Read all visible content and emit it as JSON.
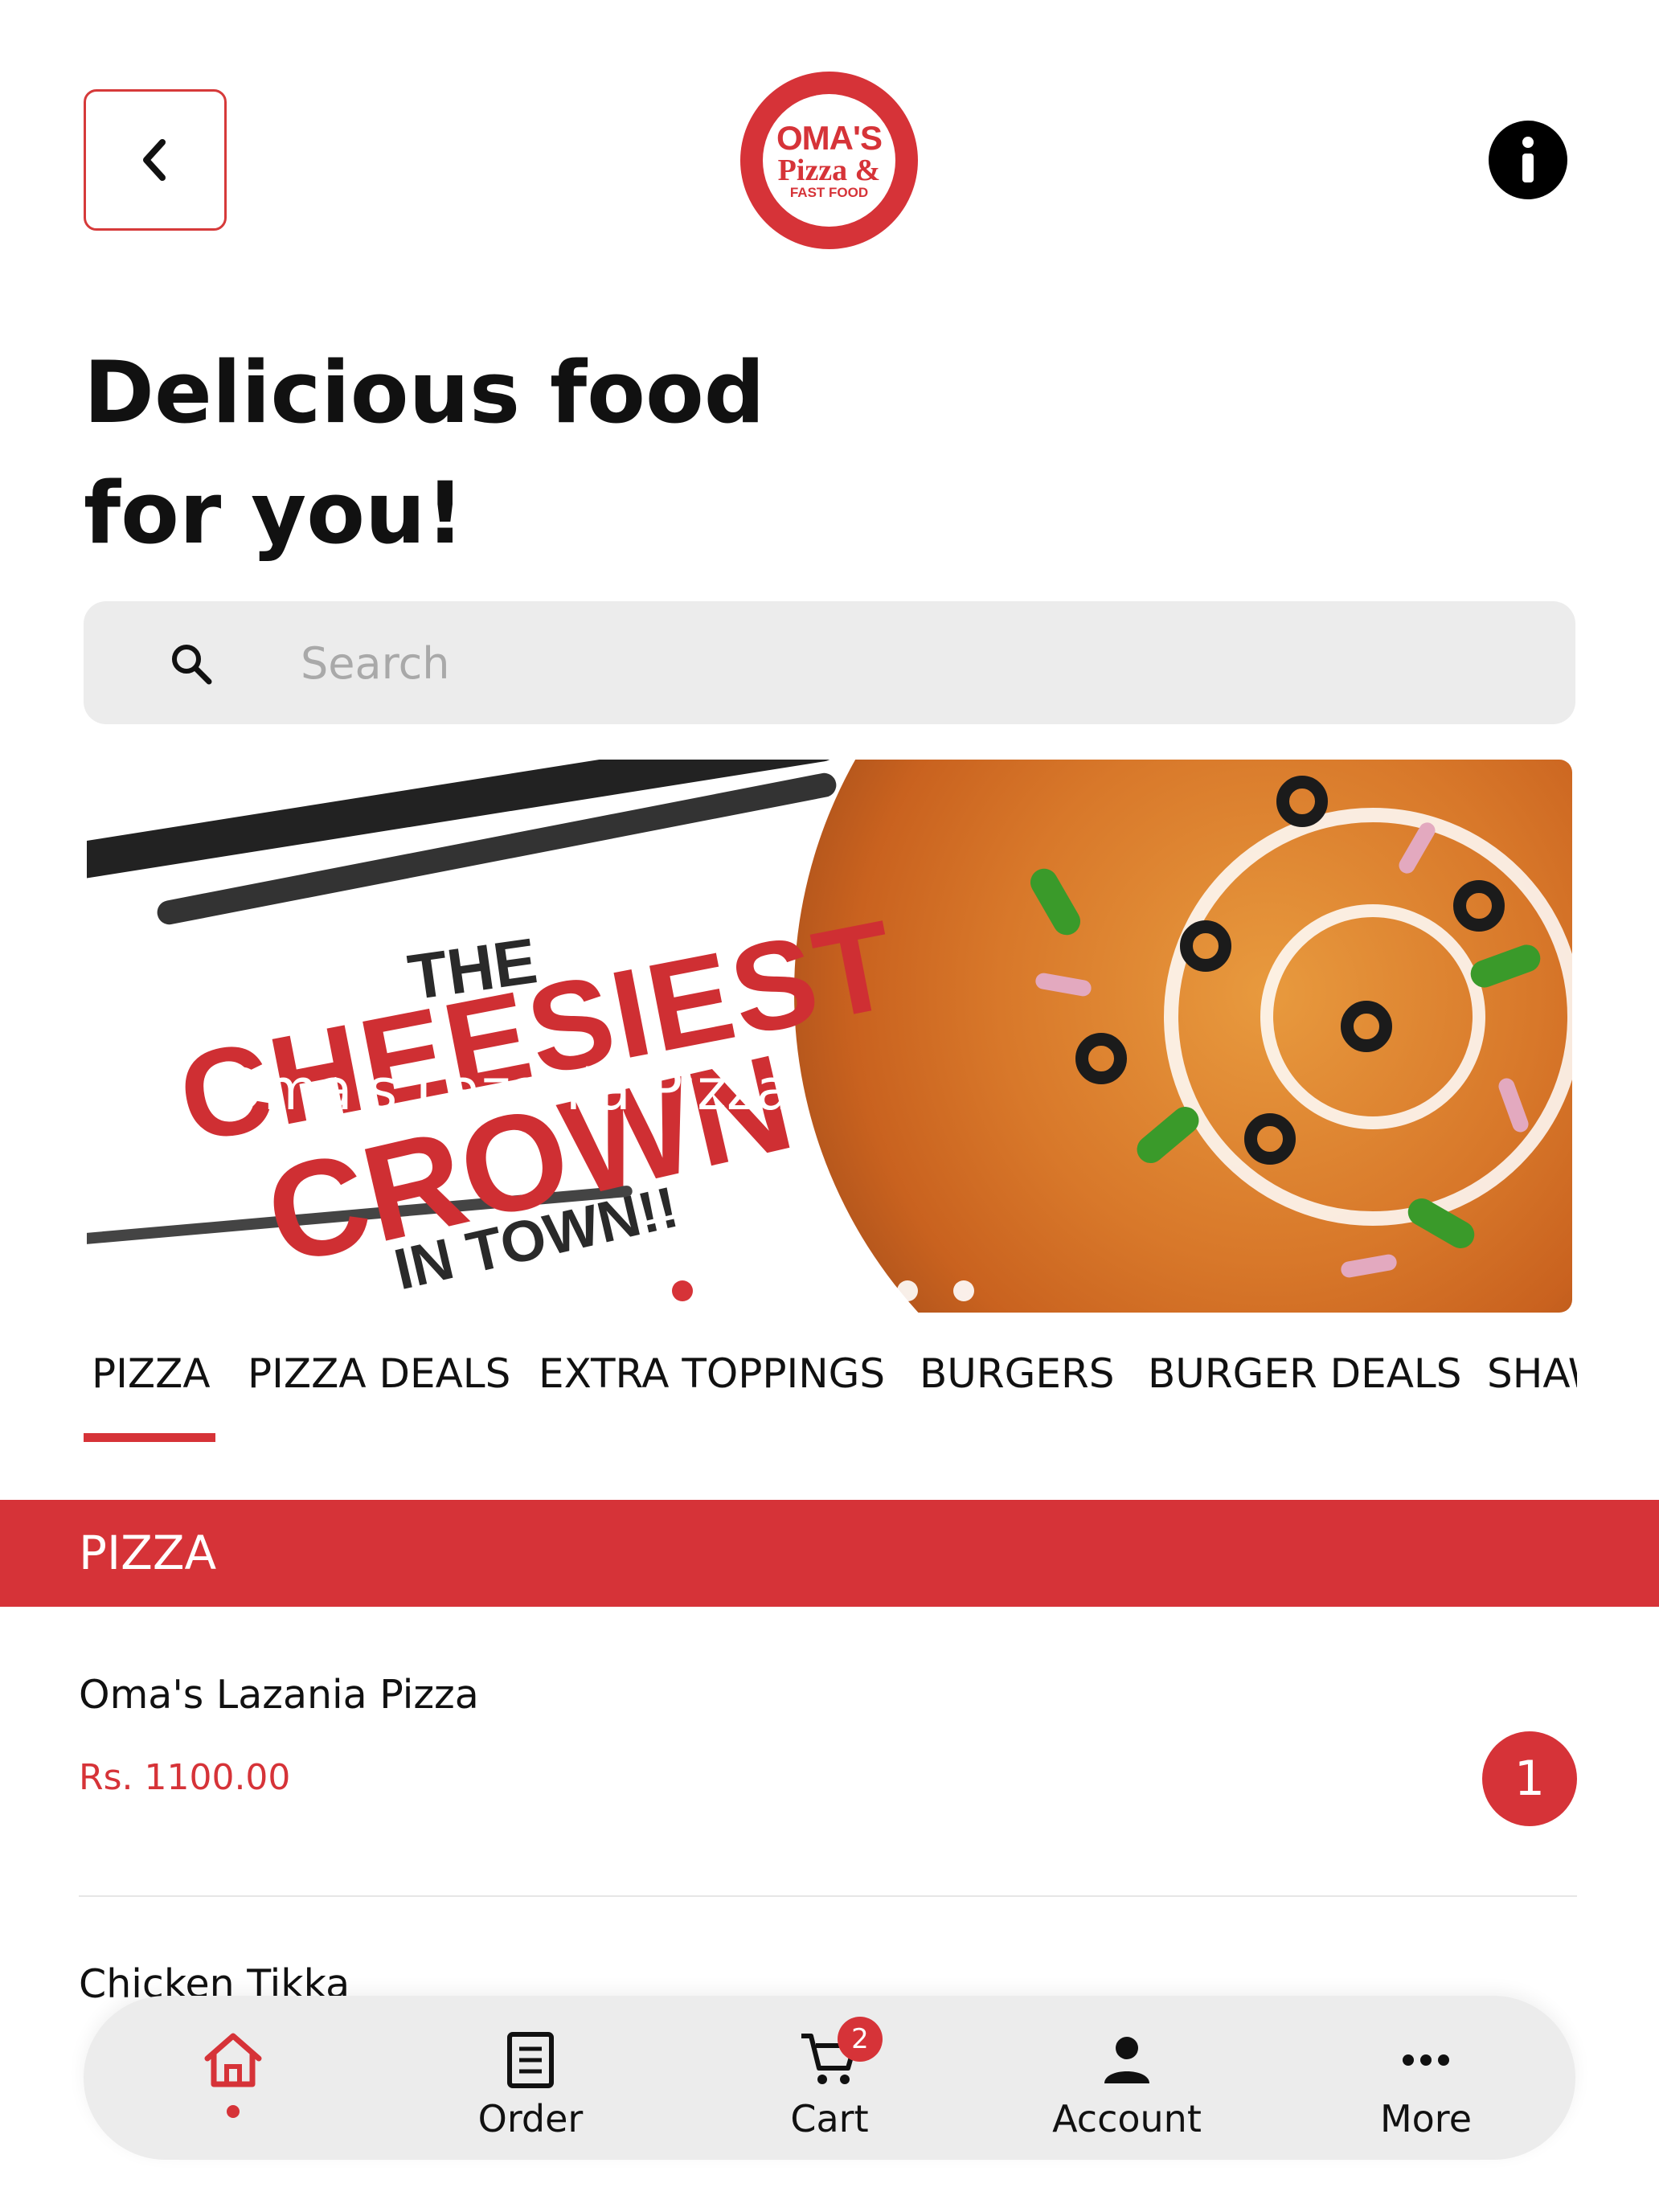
{
  "header": {
    "back_icon": "chevron-left-icon",
    "logo": {
      "line1": "OMA'S",
      "line2": "Pizza &",
      "line3": "FAST FOOD"
    },
    "info_icon": "info-icon"
  },
  "headline": {
    "line1": "Delicious food",
    "line2": "for you!"
  },
  "search": {
    "placeholder": "Search",
    "icon": "search-icon"
  },
  "banner": {
    "promo_the": "THE",
    "promo_cheesiest": "CHEESIEST",
    "promo_crown": "CROWN",
    "promo_town": "IN TOWN!!",
    "overlay_title": "Oma's Lazania Pizza",
    "slides_count": 6,
    "active_slide": 1
  },
  "categories": {
    "active": "PIZZA",
    "tabs": [
      {
        "label": "PIZZA"
      },
      {
        "label": "PIZZA DEALS"
      },
      {
        "label": "EXTRA TOPPINGS"
      },
      {
        "label": "BURGERS"
      },
      {
        "label": "BURGER DEALS"
      },
      {
        "label": "SHAWARMA"
      }
    ]
  },
  "section": {
    "title": "PIZZA"
  },
  "items": [
    {
      "name": "Oma's Lazania Pizza",
      "price": "Rs. 1100.00",
      "quantity": "1"
    },
    {
      "name": "Chicken Tikka"
    }
  ],
  "bottom_nav": {
    "active": "home",
    "items": [
      {
        "label": "",
        "icon": "home-icon"
      },
      {
        "label": "Order",
        "icon": "order-list-icon"
      },
      {
        "label": "Cart",
        "icon": "cart-icon",
        "badge": "2"
      },
      {
        "label": "Account",
        "icon": "account-icon"
      },
      {
        "label": "More",
        "icon": "more-dots-icon"
      }
    ]
  },
  "colors": {
    "accent": "#d63338",
    "surface": "#ececec",
    "text": "#111111"
  }
}
